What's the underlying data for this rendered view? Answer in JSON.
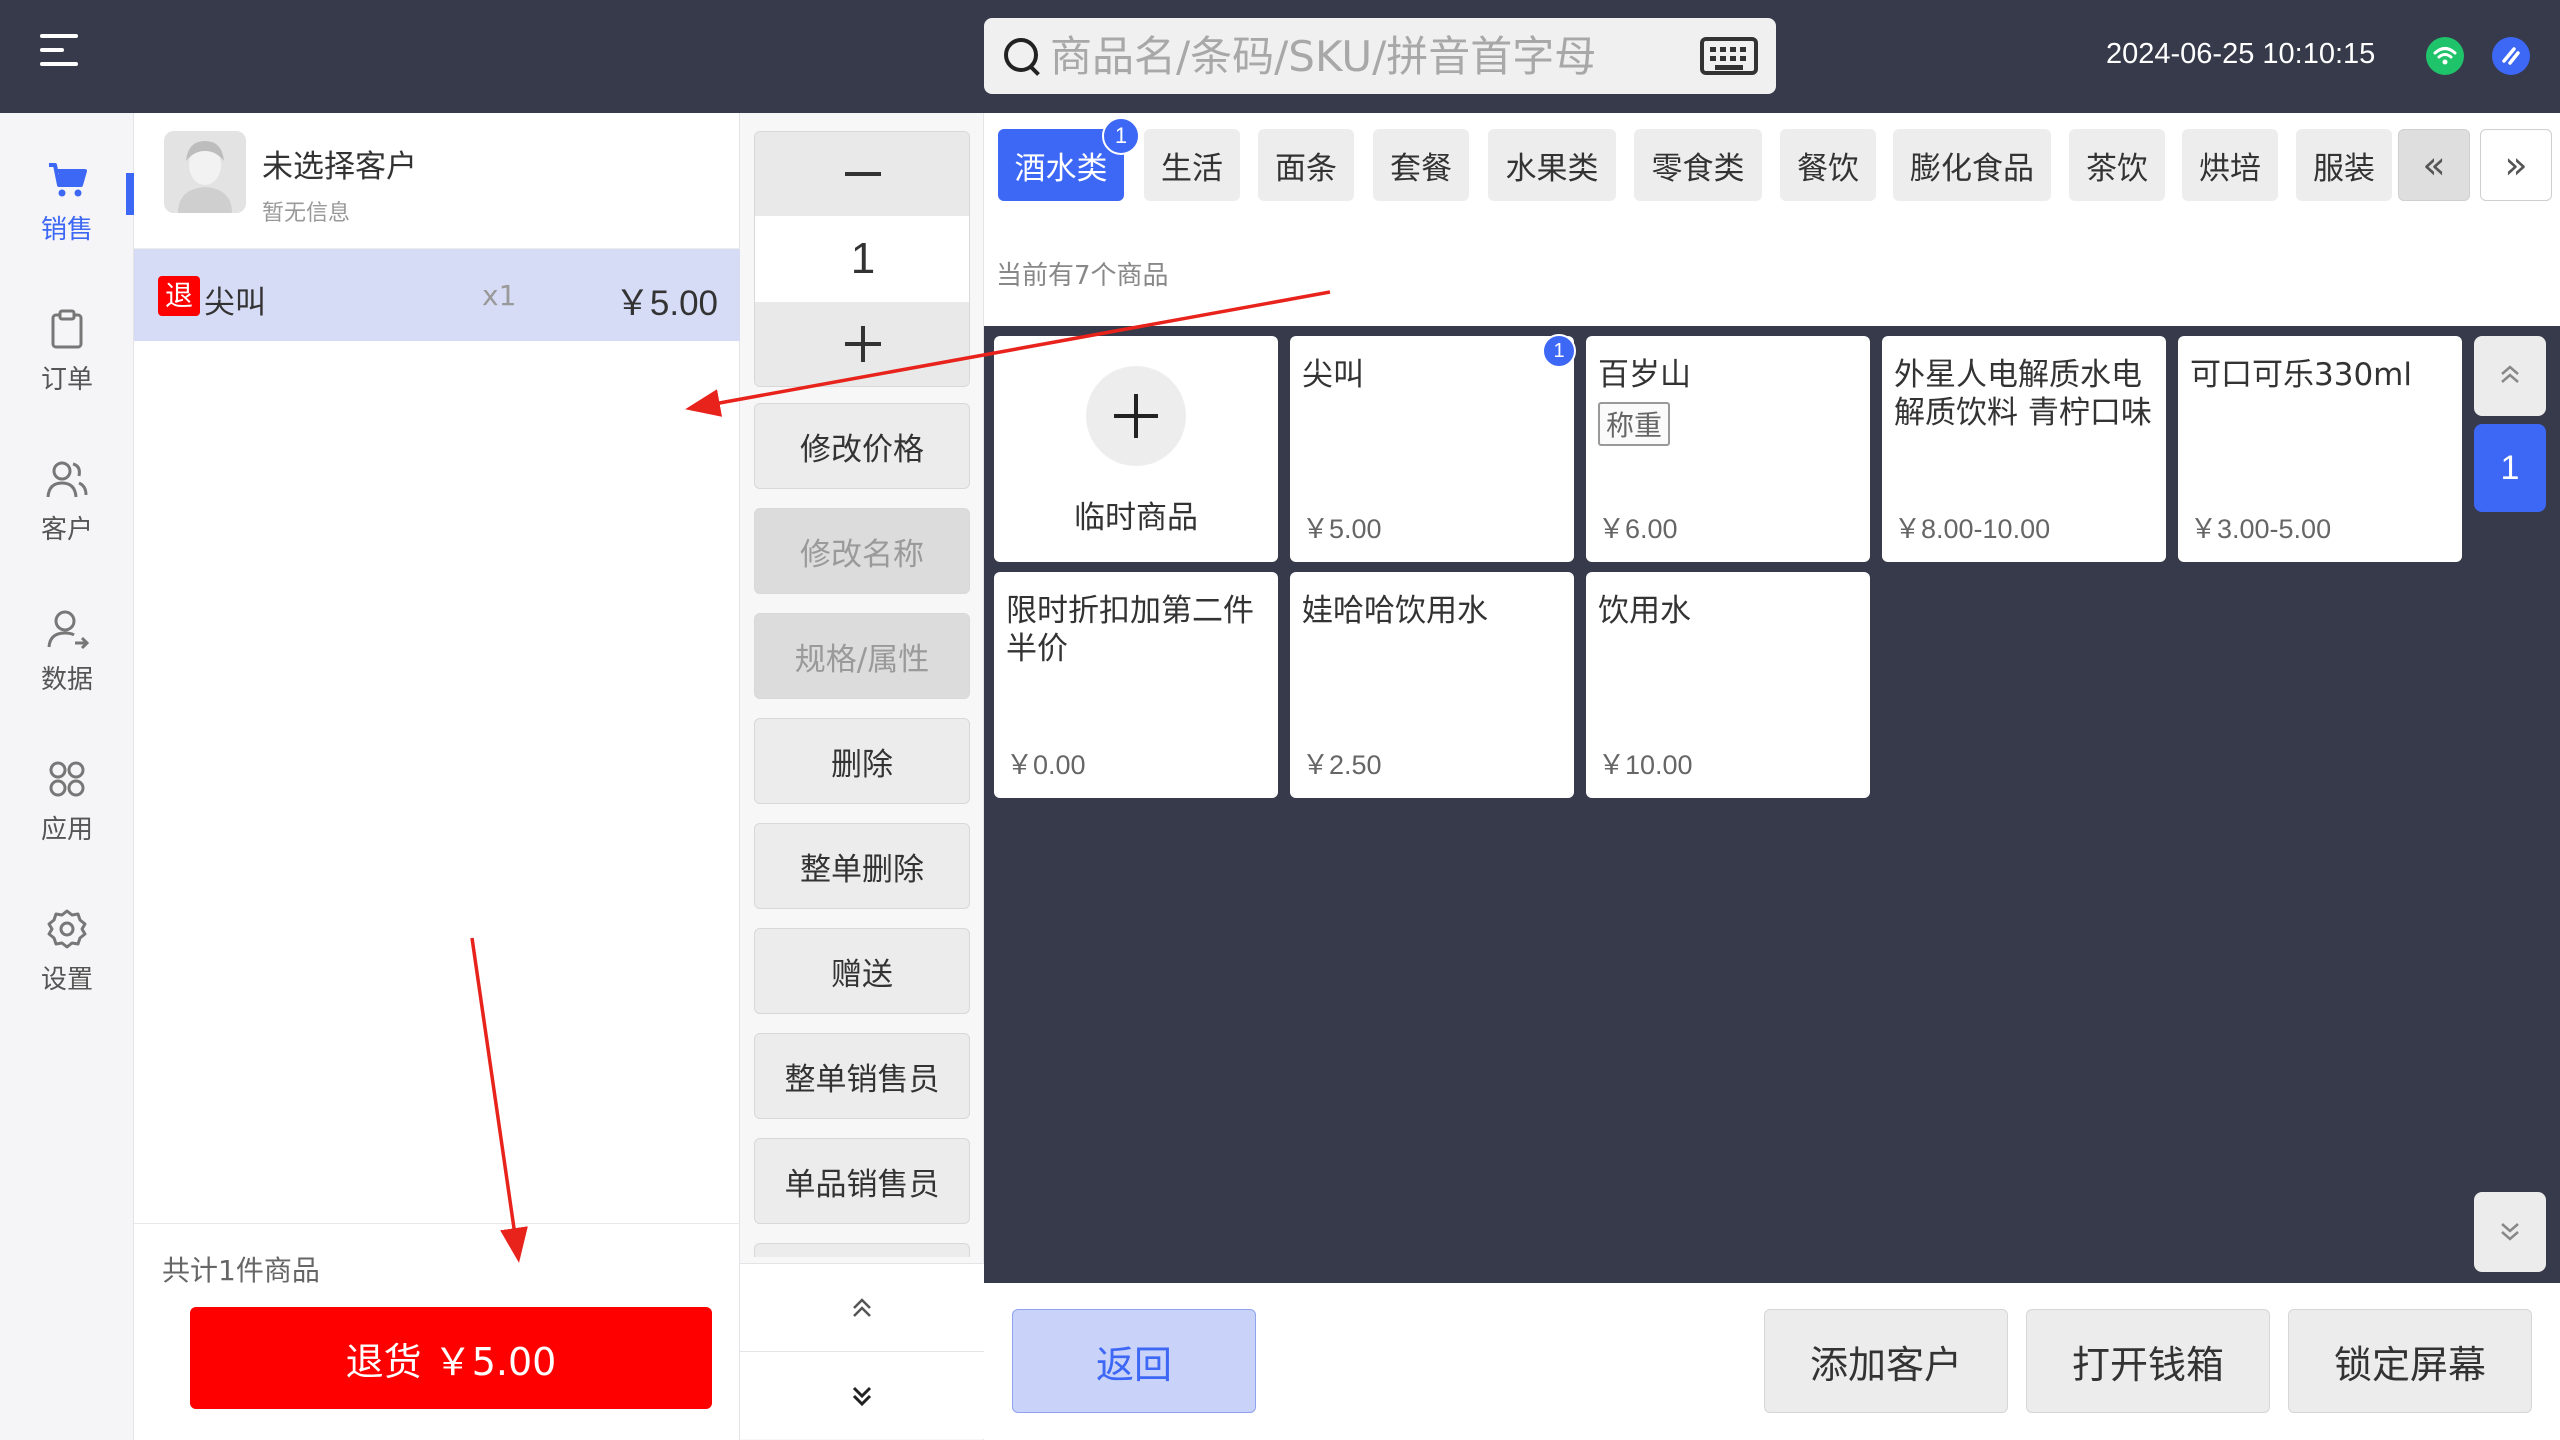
{
  "topbar": {
    "search_placeholder": "商品名/条码/SKU/拼音首字母",
    "datetime": "2024-06-25 10:10:15"
  },
  "nav": {
    "items": [
      {
        "label": "销售",
        "icon": "cart-icon",
        "active": true
      },
      {
        "label": "订单",
        "icon": "clipboard-icon",
        "active": false
      },
      {
        "label": "客户",
        "icon": "users-icon",
        "active": false
      },
      {
        "label": "数据",
        "icon": "user-chart-icon",
        "active": false
      },
      {
        "label": "应用",
        "icon": "apps-grid-icon",
        "active": false
      },
      {
        "label": "设置",
        "icon": "gear-icon",
        "active": false
      }
    ]
  },
  "cart": {
    "customer_name": "未选择客户",
    "customer_info": "暂无信息",
    "items": [
      {
        "tag": "退",
        "name": "尖叫",
        "qty": "x1",
        "price": "￥5.00"
      }
    ],
    "total_count": "共计1件商品",
    "refund_button": "退货 ￥5.00"
  },
  "actions": {
    "quantity": "1",
    "buttons": [
      {
        "label": "修改价格",
        "enabled": true
      },
      {
        "label": "修改名称",
        "enabled": false
      },
      {
        "label": "规格/属性",
        "enabled": false
      },
      {
        "label": "删除",
        "enabled": true
      },
      {
        "label": "整单删除",
        "enabled": true
      },
      {
        "label": "赠送",
        "enabled": true
      },
      {
        "label": "整单销售员",
        "enabled": true
      },
      {
        "label": "单品销售员",
        "enabled": true
      }
    ]
  },
  "categories": {
    "tabs": [
      {
        "label": "酒水类",
        "active": true,
        "badge": "1"
      },
      {
        "label": "生活",
        "active": false
      },
      {
        "label": "面条",
        "active": false
      },
      {
        "label": "套餐",
        "active": false
      },
      {
        "label": "水果类",
        "active": false
      },
      {
        "label": "零食类",
        "active": false
      },
      {
        "label": "餐饮",
        "active": false
      },
      {
        "label": "膨化食品",
        "active": false
      },
      {
        "label": "茶饮",
        "active": false
      },
      {
        "label": "烘培",
        "active": false
      },
      {
        "label": "服装",
        "active": false
      }
    ],
    "prev_label": "«",
    "next_label": "»",
    "product_count": "当前有7个商品"
  },
  "products": {
    "temp_label": "临时商品",
    "items": [
      {
        "name": "尖叫",
        "price": "￥5.00",
        "badge": "1"
      },
      {
        "name": "百岁山",
        "price": "￥6.00",
        "tag": "称重"
      },
      {
        "name": "外星人电解质水电解质饮料 青柠口味",
        "price": "￥8.00-10.00"
      },
      {
        "name": "可口可乐330ml",
        "price": "￥3.00-5.00"
      },
      {
        "name": "限时折扣加第二件半价",
        "price": "￥0.00"
      },
      {
        "name": "娃哈哈饮用水",
        "price": "￥2.50"
      },
      {
        "name": "饮用水",
        "price": "￥10.00"
      }
    ],
    "page": "1"
  },
  "bottombar": {
    "back": "返回",
    "add_customer": "添加客户",
    "open_drawer": "打开钱箱",
    "lock_screen": "锁定屏幕"
  },
  "colors": {
    "accent": "#3d67f5",
    "topbar_bg": "#363a4a",
    "refund_red": "#ff0000",
    "cart_row_bg": "#d7dcf6",
    "annotation_arrow": "#e8231c"
  }
}
